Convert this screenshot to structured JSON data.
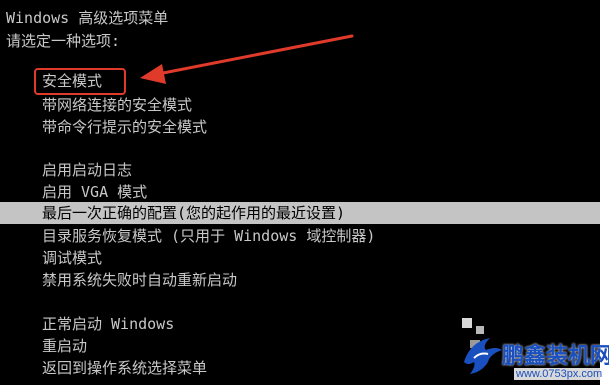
{
  "window": {
    "title": "Windows 高级选项菜单",
    "prompt": "请选定一种选项:"
  },
  "menu": {
    "safe_mode": "安全模式",
    "safe_mode_network": "带网络连接的安全模式",
    "safe_mode_cmd": "带命令行提示的安全模式",
    "boot_logging": "启用启动日志",
    "vga_mode": "启用 VGA 模式",
    "last_known_good": "最后一次正确的配置(您的起作用的最近设置)",
    "ds_restore": "目录服务恢复模式 (只用于 Windows 域控制器)",
    "debug_mode": "调试模式",
    "disable_auto_restart": "禁用系统失败时自动重新启动",
    "normal_boot": "正常启动 Windows",
    "reboot": "重启动",
    "return_os_menu": "返回到操作系统选择菜单"
  },
  "selected_item": "last_known_good",
  "annotation": {
    "color": "#e03a2a"
  },
  "watermark": {
    "brand": "鹏鑫装机网",
    "url": "www.0753px.com"
  },
  "colors": {
    "background": "#000000",
    "text": "#c8c8c8",
    "highlight_bg": "#c4c4c4",
    "highlight_text": "#000000",
    "logo_blue": "#1a4fbf"
  }
}
